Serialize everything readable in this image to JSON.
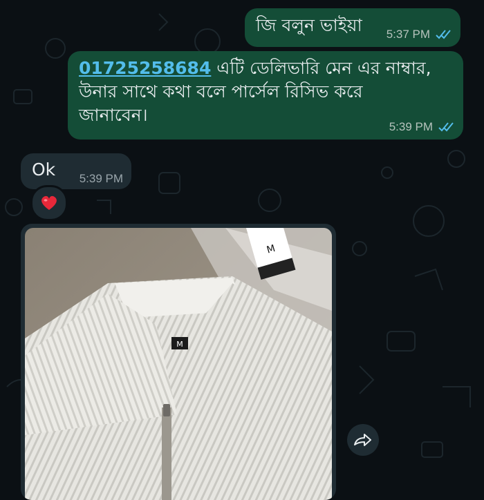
{
  "messages": [
    {
      "direction": "outgoing",
      "text": "জি বলুন ভাইয়া",
      "time": "5:37 PM",
      "status": "read"
    },
    {
      "direction": "outgoing",
      "link": "01725258684",
      "text_line1": " এটি ডেলিভারি মেন এর নাম্বার,",
      "text_line2": "উনার সাথে কথা বলে পার্সেল রিসিভ করে",
      "text_line3": "জানাবেন।",
      "time": "5:39 PM",
      "status": "read"
    },
    {
      "direction": "incoming",
      "text": "Ok",
      "time": "5:39 PM",
      "reaction": "heart"
    },
    {
      "direction": "incoming",
      "type": "image",
      "image_description": "white ribbed polo shirt with collar and zipper",
      "shirt_tag": "M",
      "hang_tag": "M",
      "forward": "forward-icon"
    }
  ],
  "colors": {
    "outgoing_bubble": "#144d37",
    "incoming_bubble": "#1f2c33",
    "background": "#0b1014",
    "link": "#53bdeb",
    "read_ticks": "#53bdeb"
  }
}
